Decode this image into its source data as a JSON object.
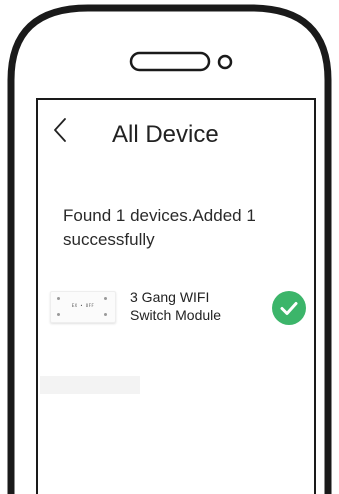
{
  "header": {
    "back_icon": "chevron-left-icon",
    "title": "All Device"
  },
  "scan_result": {
    "message": "Found 1 devices.Added 1 successfully"
  },
  "devices": [
    {
      "name_line1": "3 Gang WIFI",
      "name_line2": "Switch Module",
      "thumbnail_label": "EX • OFF",
      "status_icon": "check-circle-icon",
      "status_color": "#3cb56a"
    }
  ]
}
